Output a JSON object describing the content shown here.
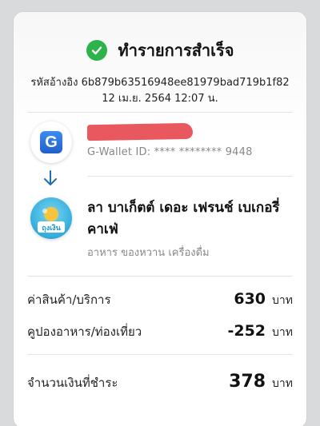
{
  "receipt": {
    "status_text": "ทำรายการสำเร็จ",
    "ref_label": "รหัสอ้างอิง",
    "ref_code": "6b879b63516948ee81979bad719b1f82",
    "datetime": "12 เม.ย. 2564 12:07 น."
  },
  "sender": {
    "logo_icon": "g-wallet-logo",
    "logo_letter": "G",
    "wallet_id": "G-Wallet ID: **** ******** 9448",
    "name_redacted": true
  },
  "merchant": {
    "logo_icon": "tung-ngern-logo",
    "logo_text": "ถุงเงิน",
    "name": "ลา บาเก็ตต์ เดอะ เฟรนช์ เบเกอรี่ คาเฟ่",
    "category": "อาหาร ของหวาน เครื่องดื่ม"
  },
  "items": [
    {
      "label": "ค่าสินค้า/บริการ",
      "amount": "630",
      "unit": "บาท"
    },
    {
      "label": "คูปองอาหาร/ท่องเที่ยว",
      "amount": "-252",
      "unit": "บาท"
    }
  ],
  "total": {
    "label": "จำนวนเงินที่ชำระ",
    "amount": "378",
    "unit": "บาท"
  },
  "colors": {
    "success": "#2eb24a",
    "link_blue": "#1f5fc9",
    "redaction": "#e8585e"
  }
}
